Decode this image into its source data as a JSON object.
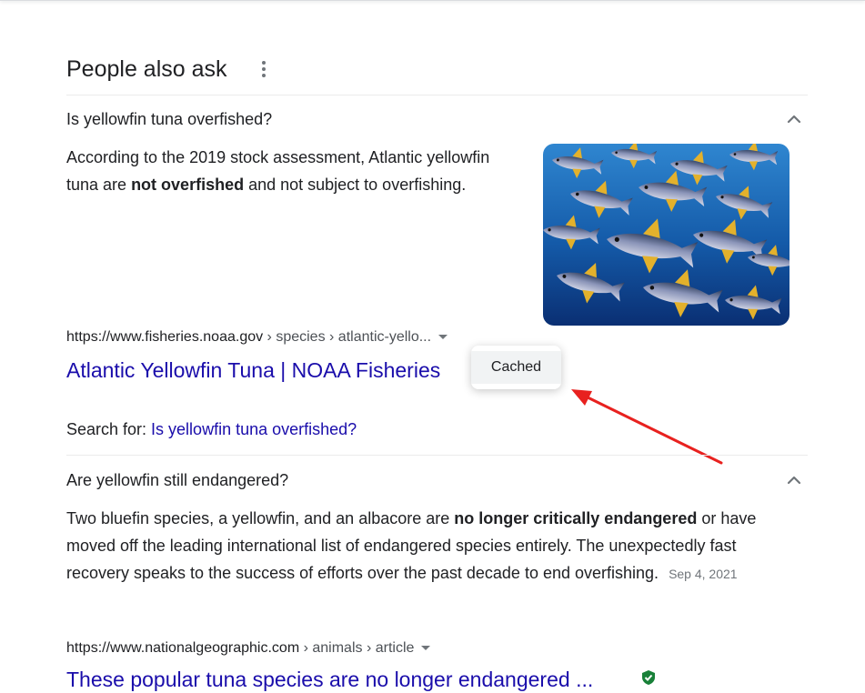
{
  "paa": {
    "title": "People also ask",
    "menu_icon": "more-vert-icon",
    "questions": [
      {
        "question": "Is yellowfin tuna overfished?",
        "expanded": true,
        "answer": {
          "prefix": "According to the 2019 stock assessment, Atlantic yellowfin tuna are ",
          "bold": "not overfished",
          "suffix": " and not subject to overfishing."
        },
        "thumbnail": "school-of-yellowfin-tuna-photo",
        "citation": {
          "domain": "https://www.fisheries.noaa.gov",
          "path": " › species › atlantic-yello..."
        },
        "result_title": "Atlantic Yellowfin Tuna | NOAA Fisheries",
        "search_for": {
          "label": "Search for: ",
          "query": "Is yellowfin tuna overfished?"
        }
      },
      {
        "question": "Are yellowfin still endangered?",
        "expanded": true,
        "answer": {
          "prefix": "Two bluefin species, a yellowfin, and an albacore are ",
          "bold": "no longer critically endangered",
          "suffix": " or have moved off the leading international list of endangered species entirely. The unexpectedly fast recovery speaks to the success of efforts over the past decade to end overfishing.",
          "date": "Sep 4, 2021"
        },
        "citation": {
          "domain": "https://www.nationalgeographic.com",
          "path": " › animals › article"
        },
        "result_title": "These popular tuna species are no longer endangered ..."
      }
    ]
  },
  "result_menu": {
    "items": [
      "Cached"
    ]
  },
  "annotation": {
    "arrow_color": "#e8211f"
  },
  "colors": {
    "link": "#1a0dab",
    "text": "#202124",
    "secondary": "#70757a",
    "verified": "#188038"
  }
}
